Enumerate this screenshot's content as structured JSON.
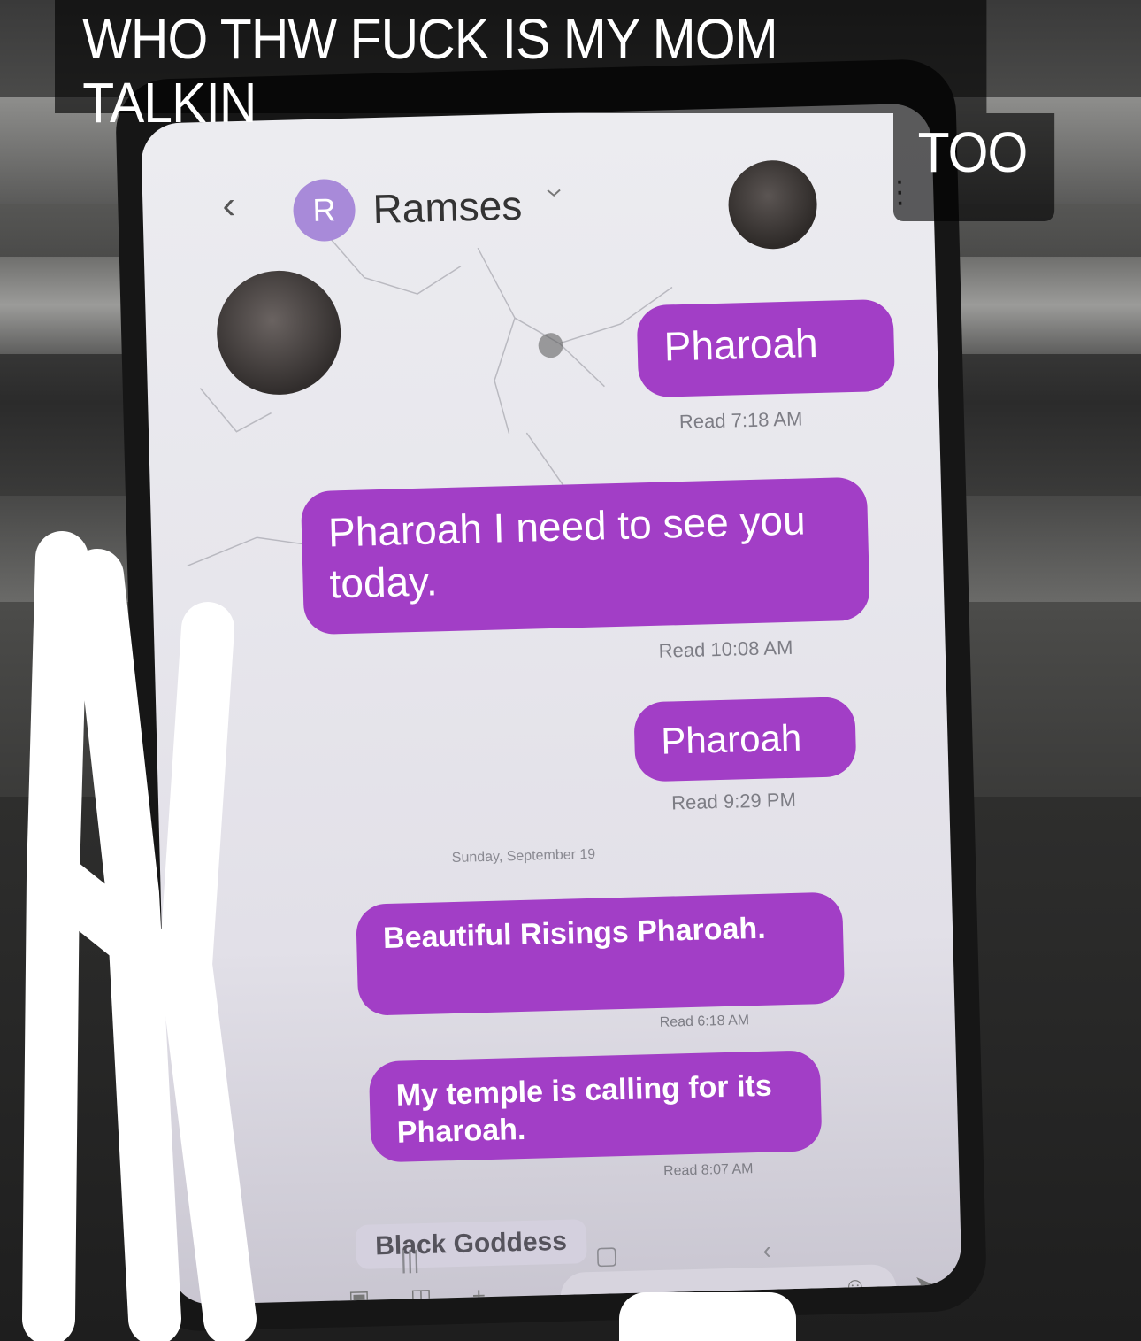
{
  "caption": {
    "line1": "WHO THW FUCK IS MY MOM TALKIN",
    "line2": "TOO"
  },
  "conversation": {
    "contact_initial": "R",
    "contact_name": "Ramses",
    "day_separator": "Sunday, September 19",
    "messages": [
      {
        "text": "Pharoah",
        "meta": "Read 7:18 AM"
      },
      {
        "text": "Pharoah I need to see you today.",
        "meta": "Read 10:08 AM"
      },
      {
        "text": "Pharoah",
        "meta": "Read 9:29 PM"
      },
      {
        "text": "Beautiful Risings Pharoah.",
        "meta": "Read 6:18 AM"
      },
      {
        "text": "My temple is calling for its Pharoah.",
        "meta": "Read 8:07 AM"
      }
    ],
    "suggestion": "Black Goddess"
  },
  "icons": {
    "back": "chevron-left-icon",
    "menu": "more-vertical-icon",
    "gallery": "gallery-icon",
    "camera": "camera-icon",
    "add": "plus-icon",
    "emoji": "emoji-icon",
    "send": "send-icon"
  },
  "colors": {
    "bubble": "#a23ec6",
    "avatar_r": "#a88ad9"
  }
}
